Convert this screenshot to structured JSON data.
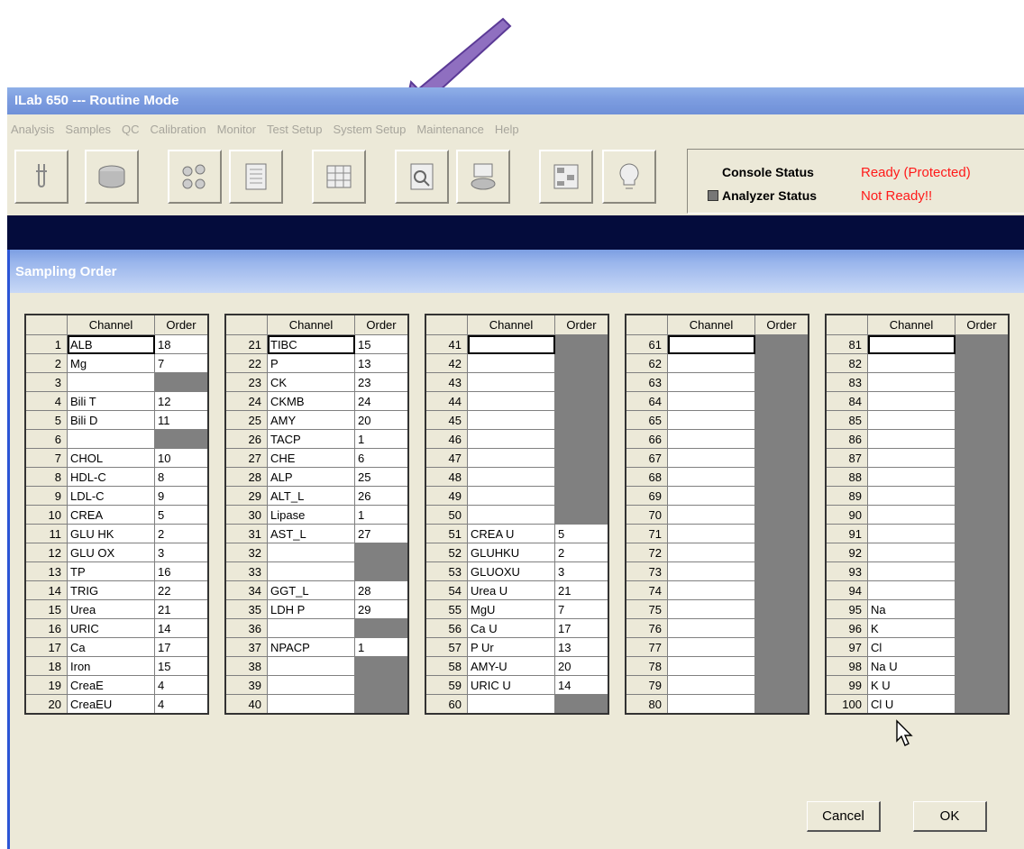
{
  "window": {
    "title": "ILab 650 --- Routine Mode"
  },
  "menu": [
    "Analysis",
    "Samples",
    "QC",
    "Calibration",
    "Monitor",
    "Test Setup",
    "System Setup",
    "Maintenance",
    "Help"
  ],
  "toolbar": {
    "buttons": [
      "test-tube-icon",
      "sample-tray-icon",
      "reagent-bottles-icon",
      "results-list-icon",
      "grid-table-icon",
      "search-document-icon",
      "printer-disk-icon",
      "layout-chart-icon",
      "lightbulb-icon"
    ]
  },
  "status": {
    "console_label": "Console Status",
    "console_value": "Ready (Protected)",
    "analyzer_label": "Analyzer Status",
    "analyzer_value": "Not Ready!!",
    "alert_color": "#ff1a1a"
  },
  "dialog": {
    "title": "Sampling Order",
    "col_channel": "Channel",
    "col_order": "Order",
    "cancel_label": "Cancel",
    "ok_label": "OK"
  },
  "channels": [
    {
      "n": "1",
      "ch": "ALB",
      "o": "18"
    },
    {
      "n": "2",
      "ch": "Mg",
      "o": "7"
    },
    {
      "n": "3",
      "ch": "",
      "o": null
    },
    {
      "n": "4",
      "ch": "Bili T",
      "o": "12"
    },
    {
      "n": "5",
      "ch": "Bili D",
      "o": "11"
    },
    {
      "n": "6",
      "ch": "",
      "o": null
    },
    {
      "n": "7",
      "ch": "CHOL",
      "o": "10"
    },
    {
      "n": "8",
      "ch": "HDL-C",
      "o": "8"
    },
    {
      "n": "9",
      "ch": "LDL-C",
      "o": "9"
    },
    {
      "n": "10",
      "ch": "CREA",
      "o": "5"
    },
    {
      "n": "11",
      "ch": "GLU HK",
      "o": "2"
    },
    {
      "n": "12",
      "ch": "GLU OX",
      "o": "3"
    },
    {
      "n": "13",
      "ch": "TP",
      "o": "16"
    },
    {
      "n": "14",
      "ch": "TRIG",
      "o": "22"
    },
    {
      "n": "15",
      "ch": "Urea",
      "o": "21"
    },
    {
      "n": "16",
      "ch": "URIC",
      "o": "14"
    },
    {
      "n": "17",
      "ch": "Ca",
      "o": "17"
    },
    {
      "n": "18",
      "ch": "Iron",
      "o": "15"
    },
    {
      "n": "19",
      "ch": "CreaE",
      "o": "4"
    },
    {
      "n": "20",
      "ch": "CreaEU",
      "o": "4"
    },
    {
      "n": "21",
      "ch": "TIBC",
      "o": "15"
    },
    {
      "n": "22",
      "ch": "P",
      "o": "13"
    },
    {
      "n": "23",
      "ch": "CK",
      "o": "23"
    },
    {
      "n": "24",
      "ch": "CKMB",
      "o": "24"
    },
    {
      "n": "25",
      "ch": "AMY",
      "o": "20"
    },
    {
      "n": "26",
      "ch": "TACP",
      "o": "1"
    },
    {
      "n": "27",
      "ch": "CHE",
      "o": "6"
    },
    {
      "n": "28",
      "ch": "ALP",
      "o": "25"
    },
    {
      "n": "29",
      "ch": "ALT_L",
      "o": "26"
    },
    {
      "n": "30",
      "ch": "Lipase",
      "o": "1"
    },
    {
      "n": "31",
      "ch": "AST_L",
      "o": "27"
    },
    {
      "n": "32",
      "ch": "",
      "o": null
    },
    {
      "n": "33",
      "ch": "",
      "o": null
    },
    {
      "n": "34",
      "ch": "GGT_L",
      "o": "28"
    },
    {
      "n": "35",
      "ch": "LDH P",
      "o": "29"
    },
    {
      "n": "36",
      "ch": "",
      "o": null
    },
    {
      "n": "37",
      "ch": "NPACP",
      "o": "1"
    },
    {
      "n": "38",
      "ch": "",
      "o": null
    },
    {
      "n": "39",
      "ch": "",
      "o": null
    },
    {
      "n": "40",
      "ch": "",
      "o": null
    },
    {
      "n": "41",
      "ch": "",
      "o": null
    },
    {
      "n": "42",
      "ch": "",
      "o": null
    },
    {
      "n": "43",
      "ch": "",
      "o": null
    },
    {
      "n": "44",
      "ch": "",
      "o": null
    },
    {
      "n": "45",
      "ch": "",
      "o": null
    },
    {
      "n": "46",
      "ch": "",
      "o": null
    },
    {
      "n": "47",
      "ch": "",
      "o": null
    },
    {
      "n": "48",
      "ch": "",
      "o": null
    },
    {
      "n": "49",
      "ch": "",
      "o": null
    },
    {
      "n": "50",
      "ch": "",
      "o": null
    },
    {
      "n": "51",
      "ch": "CREA U",
      "o": "5"
    },
    {
      "n": "52",
      "ch": "GLUHKU",
      "o": "2"
    },
    {
      "n": "53",
      "ch": "GLUOXU",
      "o": "3"
    },
    {
      "n": "54",
      "ch": "Urea U",
      "o": "21"
    },
    {
      "n": "55",
      "ch": "MgU",
      "o": "7"
    },
    {
      "n": "56",
      "ch": "Ca U",
      "o": "17"
    },
    {
      "n": "57",
      "ch": "P Ur",
      "o": "13"
    },
    {
      "n": "58",
      "ch": "AMY-U",
      "o": "20"
    },
    {
      "n": "59",
      "ch": "URIC U",
      "o": "14"
    },
    {
      "n": "60",
      "ch": "",
      "o": null
    },
    {
      "n": "61",
      "ch": "",
      "o": null
    },
    {
      "n": "62",
      "ch": "",
      "o": null
    },
    {
      "n": "63",
      "ch": "",
      "o": null
    },
    {
      "n": "64",
      "ch": "",
      "o": null
    },
    {
      "n": "65",
      "ch": "",
      "o": null
    },
    {
      "n": "66",
      "ch": "",
      "o": null
    },
    {
      "n": "67",
      "ch": "",
      "o": null
    },
    {
      "n": "68",
      "ch": "",
      "o": null
    },
    {
      "n": "69",
      "ch": "",
      "o": null
    },
    {
      "n": "70",
      "ch": "",
      "o": null
    },
    {
      "n": "71",
      "ch": "",
      "o": null
    },
    {
      "n": "72",
      "ch": "",
      "o": null
    },
    {
      "n": "73",
      "ch": "",
      "o": null
    },
    {
      "n": "74",
      "ch": "",
      "o": null
    },
    {
      "n": "75",
      "ch": "",
      "o": null
    },
    {
      "n": "76",
      "ch": "",
      "o": null
    },
    {
      "n": "77",
      "ch": "",
      "o": null
    },
    {
      "n": "78",
      "ch": "",
      "o": null
    },
    {
      "n": "79",
      "ch": "",
      "o": null
    },
    {
      "n": "80",
      "ch": "",
      "o": null
    },
    {
      "n": "81",
      "ch": "",
      "o": null
    },
    {
      "n": "82",
      "ch": "",
      "o": null
    },
    {
      "n": "83",
      "ch": "",
      "o": null
    },
    {
      "n": "84",
      "ch": "",
      "o": null
    },
    {
      "n": "85",
      "ch": "",
      "o": null
    },
    {
      "n": "86",
      "ch": "",
      "o": null
    },
    {
      "n": "87",
      "ch": "",
      "o": null
    },
    {
      "n": "88",
      "ch": "",
      "o": null
    },
    {
      "n": "89",
      "ch": "",
      "o": null
    },
    {
      "n": "90",
      "ch": "",
      "o": null
    },
    {
      "n": "91",
      "ch": "",
      "o": null
    },
    {
      "n": "92",
      "ch": "",
      "o": null
    },
    {
      "n": "93",
      "ch": "",
      "o": null
    },
    {
      "n": "94",
      "ch": "",
      "o": null
    },
    {
      "n": "95",
      "ch": "Na",
      "o": null
    },
    {
      "n": "96",
      "ch": "K",
      "o": null
    },
    {
      "n": "97",
      "ch": "Cl",
      "o": null
    },
    {
      "n": "98",
      "ch": "Na U",
      "o": null
    },
    {
      "n": "99",
      "ch": "K U",
      "o": null
    },
    {
      "n": "100",
      "ch": "Cl U",
      "o": null
    }
  ]
}
